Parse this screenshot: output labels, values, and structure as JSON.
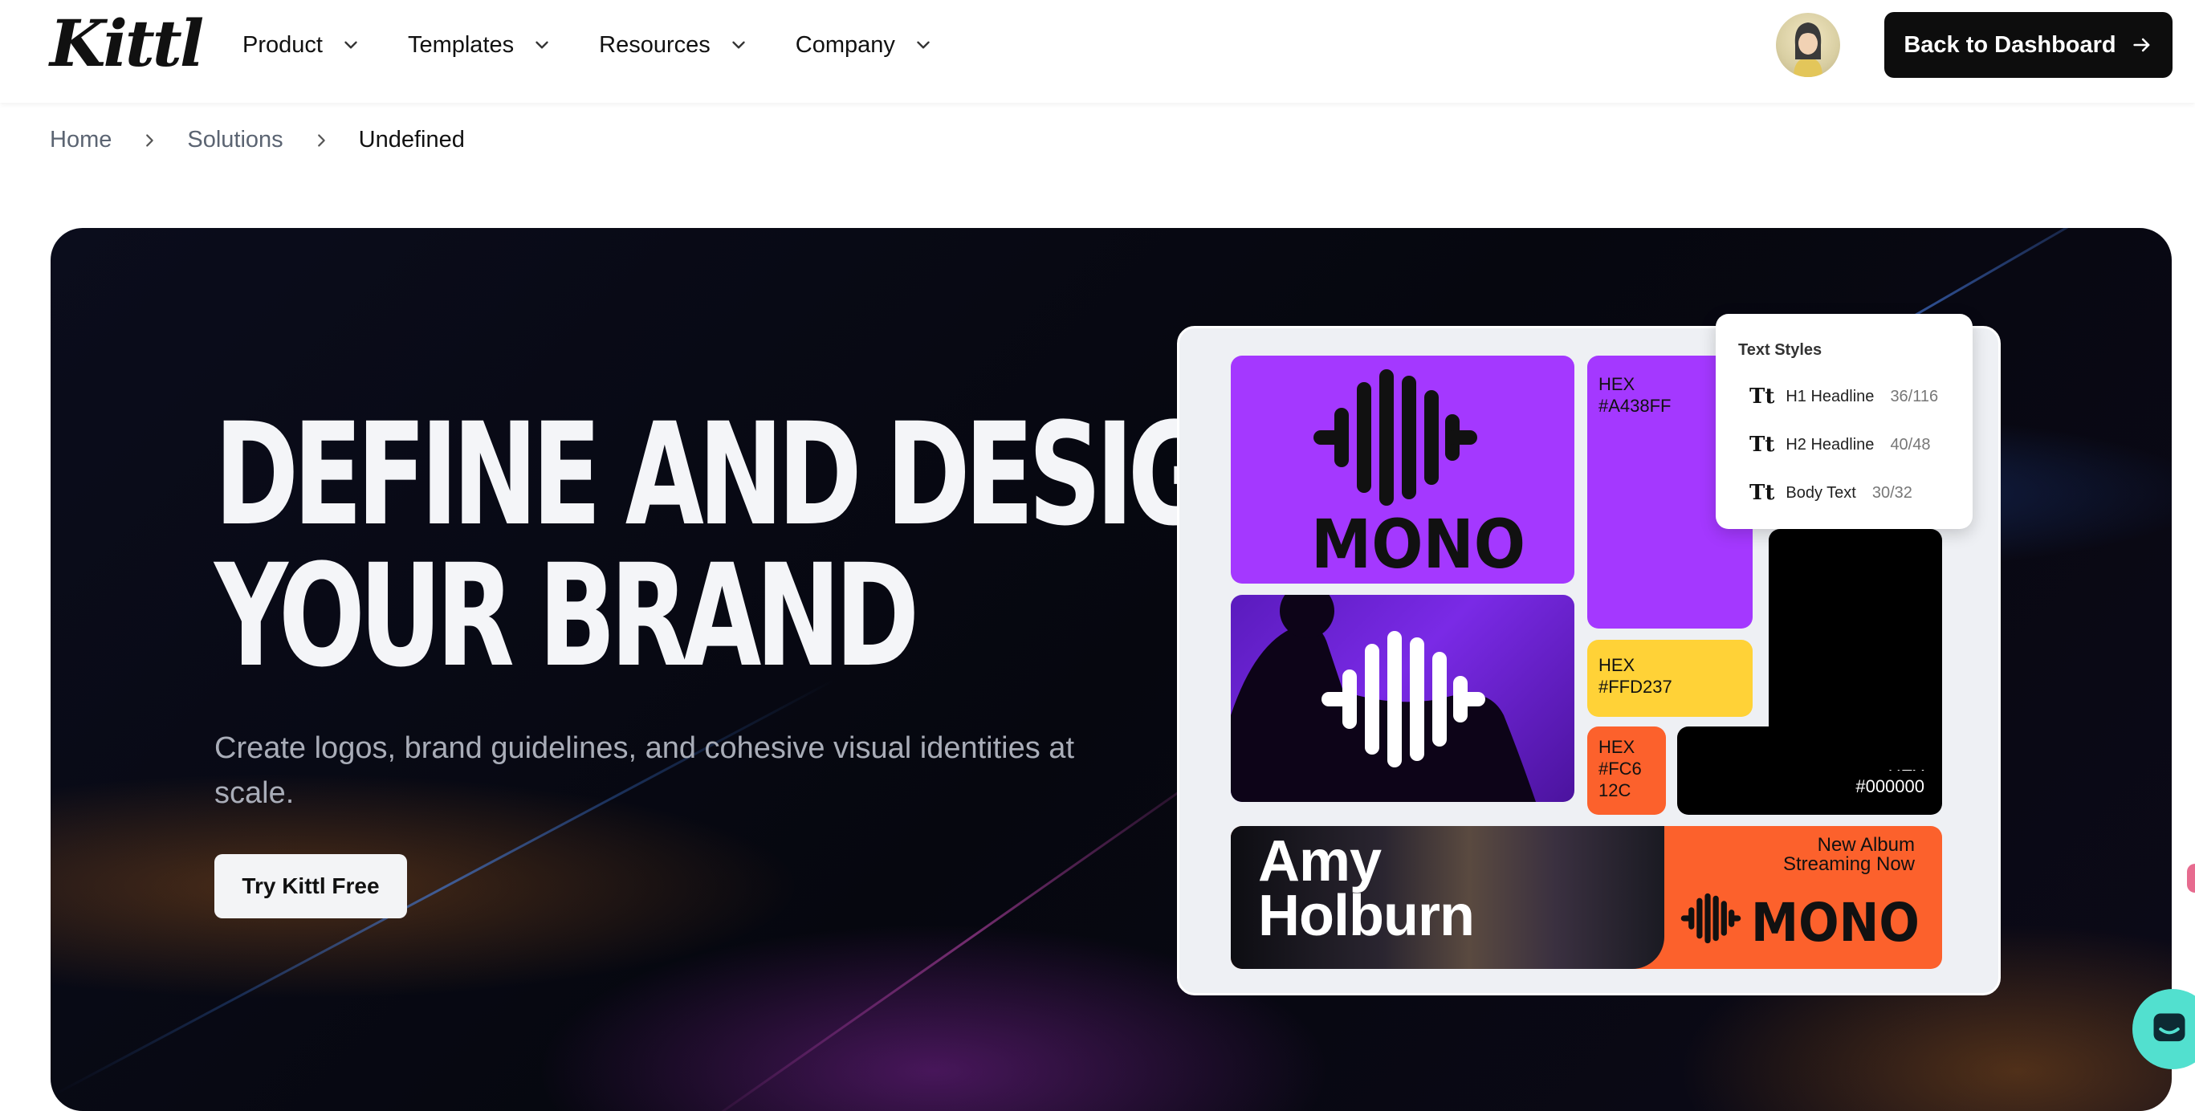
{
  "header": {
    "logo": "Kittl",
    "nav": [
      {
        "label": "Product"
      },
      {
        "label": "Templates"
      },
      {
        "label": "Resources"
      },
      {
        "label": "Company"
      }
    ],
    "dashboard_button": "Back to Dashboard"
  },
  "breadcrumb": {
    "items": [
      "Home",
      "Solutions"
    ],
    "current": "Undefined"
  },
  "hero": {
    "title_line1": "DEFINE AND DESIGN",
    "title_line2": "YOUR BRAND",
    "subtitle": "Create logos, brand guidelines, and cohesive visual identities at scale.",
    "cta": "Try Kittl Free"
  },
  "brand_board": {
    "brand_name": "MONO",
    "colors": [
      {
        "label": "HEX",
        "value": "#A438FF"
      },
      {
        "label": "HEX",
        "value": "#FFD237"
      },
      {
        "label": "HEX",
        "value": "#FC612C",
        "display_lines": [
          "#FC6",
          "12C"
        ]
      },
      {
        "label": "HEX",
        "value": "#000000"
      }
    ],
    "text_styles": {
      "title": "Text Styles",
      "rows": [
        {
          "name": "H1 Headline",
          "size": "36/116"
        },
        {
          "name": "H2 Headline",
          "size": "40/48"
        },
        {
          "name": "Body Text",
          "size": "30/32"
        }
      ]
    },
    "banner": {
      "artist_line1": "Amy",
      "artist_line2": "Holburn",
      "tagline_line1": "New Album",
      "tagline_line2": "Streaming Now",
      "brand": "MONO"
    }
  },
  "icons": {
    "nav_chevron": "chevron-down-icon",
    "breadcrumb_separator": "chevron-right-icon",
    "dashboard_arrow": "arrow-right-icon",
    "text_style": "text-type-icon",
    "waveform": "waveform-logo-icon",
    "chat": "chat-icon"
  },
  "colors": {
    "purple": "#A438FF",
    "yellow": "#FFD237",
    "orange": "#FC612C",
    "black": "#000000",
    "chat_bubble": "#52E0CF"
  }
}
